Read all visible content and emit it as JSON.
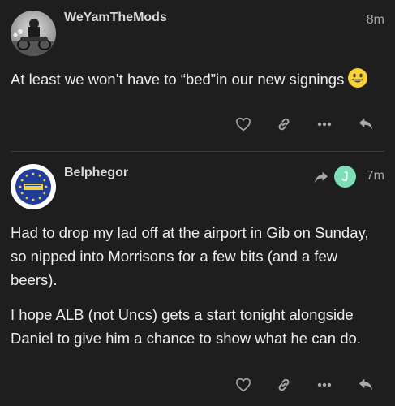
{
  "posts": [
    {
      "username": "WeYamTheMods",
      "time": "8m",
      "body": [
        "At least we won’t have to “bed”in our new signings"
      ],
      "emoji": "grinning-face"
    },
    {
      "username": "Belphegor",
      "time": "7m",
      "reply_to_initial": "J",
      "body": [
        "Had to drop my lad off at the airport in Gib on Sunday, so nipped into Morrisons for a few bits (and a few beers).",
        "I hope ALB (not Uncs) gets a start tonight alongside Daniel to give him a chance to show what he can do."
      ]
    }
  ],
  "colors": {
    "background": "#1e1e1e",
    "text": "#ededed",
    "muted": "#a8a8a8",
    "reply_avatar": "#7ddfb5"
  }
}
